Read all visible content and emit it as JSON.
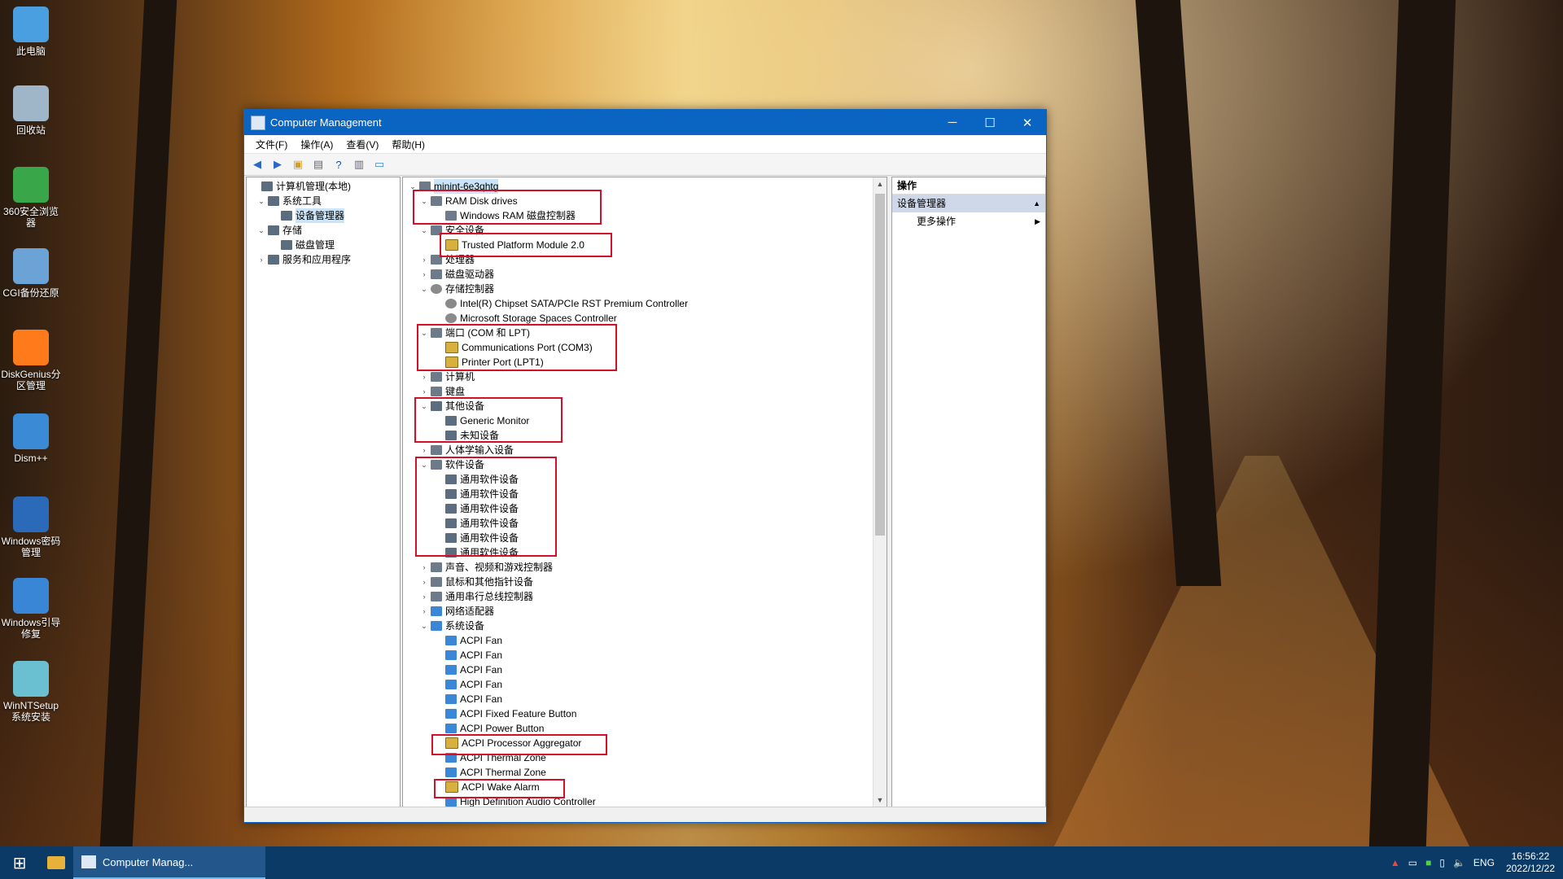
{
  "desktop": {
    "icons": [
      {
        "label": "此电脑",
        "icon": "computer-icon"
      },
      {
        "label": "回收站",
        "icon": "recycle-bin-icon"
      },
      {
        "label": "360安全浏览器",
        "icon": "browser-icon"
      },
      {
        "label": "CGI备份还原",
        "icon": "backup-icon"
      },
      {
        "label": "DiskGenius分区管理",
        "icon": "diskgenius-icon"
      },
      {
        "label": "Dism++",
        "icon": "gears-icon"
      },
      {
        "label": "Windows密码管理",
        "icon": "password-icon"
      },
      {
        "label": "Windows引导修复",
        "icon": "repair-icon"
      },
      {
        "label": "WinNTSetup系统安装",
        "icon": "setup-icon"
      }
    ]
  },
  "window": {
    "title": "Computer Management",
    "controls": {
      "minimize": "─",
      "maximize": "☐",
      "close": "✕"
    },
    "menu": [
      "文件(F)",
      "操作(A)",
      "查看(V)",
      "帮助(H)"
    ],
    "toolbar": [
      "back-icon",
      "forward-icon",
      "up-folder-icon",
      "show-hide-tree-icon",
      "help-icon",
      "properties-icon",
      "monitor-icon"
    ],
    "left_tree": [
      {
        "label": "计算机管理(本地)",
        "expander": "",
        "icon": "computer-management-icon"
      },
      {
        "label": "系统工具",
        "expander": "⌄",
        "icon": "tools-icon"
      },
      {
        "label": "设备管理器",
        "expander": "",
        "icon": "device-manager-icon",
        "selected": true
      },
      {
        "label": "存储",
        "expander": "⌄",
        "icon": "storage-icon"
      },
      {
        "label": "磁盘管理",
        "expander": "",
        "icon": "disk-icon"
      },
      {
        "label": "服务和应用程序",
        "expander": "›",
        "icon": "services-icon"
      }
    ],
    "device_tree": [
      {
        "label": "minint-6e3qhtg",
        "expander": "⌄",
        "icon": "computer-icon"
      },
      {
        "label": "RAM Disk drives",
        "expander": "⌄",
        "icon": "ram-icon"
      },
      {
        "label": "Windows RAM 磁盘控制器",
        "expander": "",
        "icon": "ram-icon"
      },
      {
        "label": "安全设备",
        "expander": "⌄",
        "icon": "security-icon"
      },
      {
        "label": "Trusted Platform Module 2.0",
        "expander": "",
        "icon": "warning-device-icon"
      },
      {
        "label": "处理器",
        "expander": "›",
        "icon": "processor-icon"
      },
      {
        "label": "磁盘驱动器",
        "expander": "›",
        "icon": "disk-drive-icon"
      },
      {
        "label": "存储控制器",
        "expander": "⌄",
        "icon": "storage-controller-icon"
      },
      {
        "label": "Intel(R) Chipset SATA/PCIe RST Premium Controller",
        "expander": "",
        "icon": "storage-controller-icon"
      },
      {
        "label": "Microsoft Storage Spaces Controller",
        "expander": "",
        "icon": "storage-controller-icon"
      },
      {
        "label": "端口 (COM 和 LPT)",
        "expander": "⌄",
        "icon": "port-icon"
      },
      {
        "label": "Communications Port (COM3)",
        "expander": "",
        "icon": "warning-device-icon"
      },
      {
        "label": "Printer Port (LPT1)",
        "expander": "",
        "icon": "warning-device-icon"
      },
      {
        "label": "计算机",
        "expander": "›",
        "icon": "computer-icon"
      },
      {
        "label": "键盘",
        "expander": "›",
        "icon": "keyboard-icon"
      },
      {
        "label": "其他设备",
        "expander": "⌄",
        "icon": "unknown-device-icon"
      },
      {
        "label": "Generic Monitor",
        "expander": "",
        "icon": "unknown-device-icon"
      },
      {
        "label": "未知设备",
        "expander": "",
        "icon": "unknown-device-icon"
      },
      {
        "label": "人体学输入设备",
        "expander": "›",
        "icon": "hid-icon"
      },
      {
        "label": "软件设备",
        "expander": "⌄",
        "icon": "software-device-icon"
      },
      {
        "label": "通用软件设备",
        "expander": "",
        "icon": "unknown-device-icon"
      },
      {
        "label": "通用软件设备",
        "expander": "",
        "icon": "unknown-device-icon"
      },
      {
        "label": "通用软件设备",
        "expander": "",
        "icon": "unknown-device-icon"
      },
      {
        "label": "通用软件设备",
        "expander": "",
        "icon": "unknown-device-icon"
      },
      {
        "label": "通用软件设备",
        "expander": "",
        "icon": "unknown-device-icon"
      },
      {
        "label": "通用软件设备",
        "expander": "",
        "icon": "unknown-device-icon"
      },
      {
        "label": "声音、视频和游戏控制器",
        "expander": "›",
        "icon": "audio-icon"
      },
      {
        "label": "鼠标和其他指针设备",
        "expander": "›",
        "icon": "mouse-icon"
      },
      {
        "label": "通用串行总线控制器",
        "expander": "›",
        "icon": "usb-icon"
      },
      {
        "label": "网络适配器",
        "expander": "›",
        "icon": "network-icon"
      },
      {
        "label": "系统设备",
        "expander": "⌄",
        "icon": "system-device-icon"
      },
      {
        "label": "ACPI Fan",
        "expander": "",
        "icon": "system-device-icon"
      },
      {
        "label": "ACPI Fan",
        "expander": "",
        "icon": "system-device-icon"
      },
      {
        "label": "ACPI Fan",
        "expander": "",
        "icon": "system-device-icon"
      },
      {
        "label": "ACPI Fan",
        "expander": "",
        "icon": "system-device-icon"
      },
      {
        "label": "ACPI Fan",
        "expander": "",
        "icon": "system-device-icon"
      },
      {
        "label": "ACPI Fixed Feature Button",
        "expander": "",
        "icon": "system-device-icon"
      },
      {
        "label": "ACPI Power Button",
        "expander": "",
        "icon": "system-device-icon"
      },
      {
        "label": "ACPI Processor Aggregator",
        "expander": "",
        "icon": "warning-device-icon"
      },
      {
        "label": "ACPI Thermal Zone",
        "expander": "",
        "icon": "system-device-icon"
      },
      {
        "label": "ACPI Thermal Zone",
        "expander": "",
        "icon": "system-device-icon"
      },
      {
        "label": "ACPI Wake Alarm",
        "expander": "",
        "icon": "warning-device-icon"
      },
      {
        "label": "High Definition Audio Controller",
        "expander": "",
        "icon": "system-device-icon"
      }
    ],
    "actions_pane": {
      "header": "操作",
      "selected": "设备管理器",
      "selected_arrow": "▲",
      "more": "更多操作",
      "more_arrow": "▶"
    }
  },
  "taskbar": {
    "start_icon": "windows-start-icon",
    "apps": [
      {
        "icon": "file-explorer-icon",
        "label": ""
      },
      {
        "icon": "computer-management-icon",
        "label": "Computer Manag..."
      }
    ],
    "tray": {
      "language": "ENG",
      "time": "16:56:22",
      "date": "2022/12/22"
    }
  },
  "colors": {
    "title_bar": "#0a64c2",
    "highlight_box": "#d3102a",
    "taskbar": "#0b3a66"
  }
}
